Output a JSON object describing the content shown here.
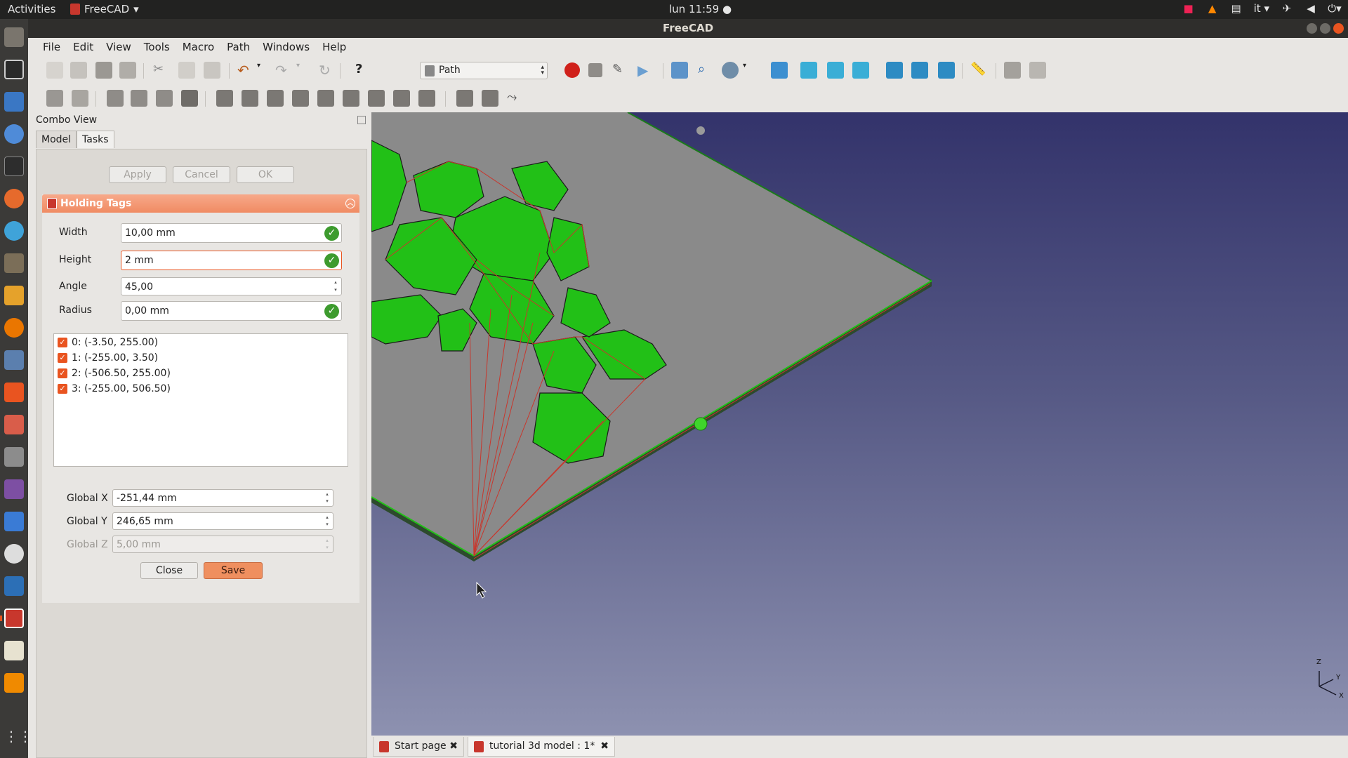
{
  "topbar": {
    "activities": "Activities",
    "app_name": "FreeCAD",
    "clock": "lun 11:59 ●",
    "lang": "it"
  },
  "window": {
    "title": "FreeCAD"
  },
  "menubar": [
    "File",
    "Edit",
    "View",
    "Tools",
    "Macro",
    "Path",
    "Windows",
    "Help"
  ],
  "toolbar": {
    "workbench": "Path"
  },
  "combo": {
    "title": "Combo View",
    "tabs": [
      "Model",
      "Tasks"
    ],
    "buttons": {
      "apply": "Apply",
      "cancel": "Cancel",
      "ok": "OK"
    }
  },
  "holding_tags": {
    "header": "Holding Tags",
    "width_label": "Width",
    "width_value": "10,00 mm",
    "height_label": "Height",
    "height_value": "2 mm",
    "angle_label": "Angle",
    "angle_value": "45,00",
    "radius_label": "Radius",
    "radius_value": "0,00 mm",
    "tags": [
      "0: (-3.50, 255.00)",
      "1: (-255.00, 3.50)",
      "2: (-506.50, 255.00)",
      "3: (-255.00, 506.50)"
    ],
    "global_x_label": "Global X",
    "global_x_value": "-251,44 mm",
    "global_y_label": "Global Y",
    "global_y_value": "246,65 mm",
    "global_z_label": "Global Z",
    "global_z_value": "5,00 mm",
    "close": "Close",
    "save": "Save"
  },
  "axis": {
    "z": "Z",
    "y": "Y",
    "x": "X"
  },
  "doc_tabs": [
    "Start page",
    "tutorial 3d model : 1*"
  ],
  "colors": {
    "accent": "#e95420",
    "model_green": "#22c017",
    "path_red": "#c8372d"
  }
}
